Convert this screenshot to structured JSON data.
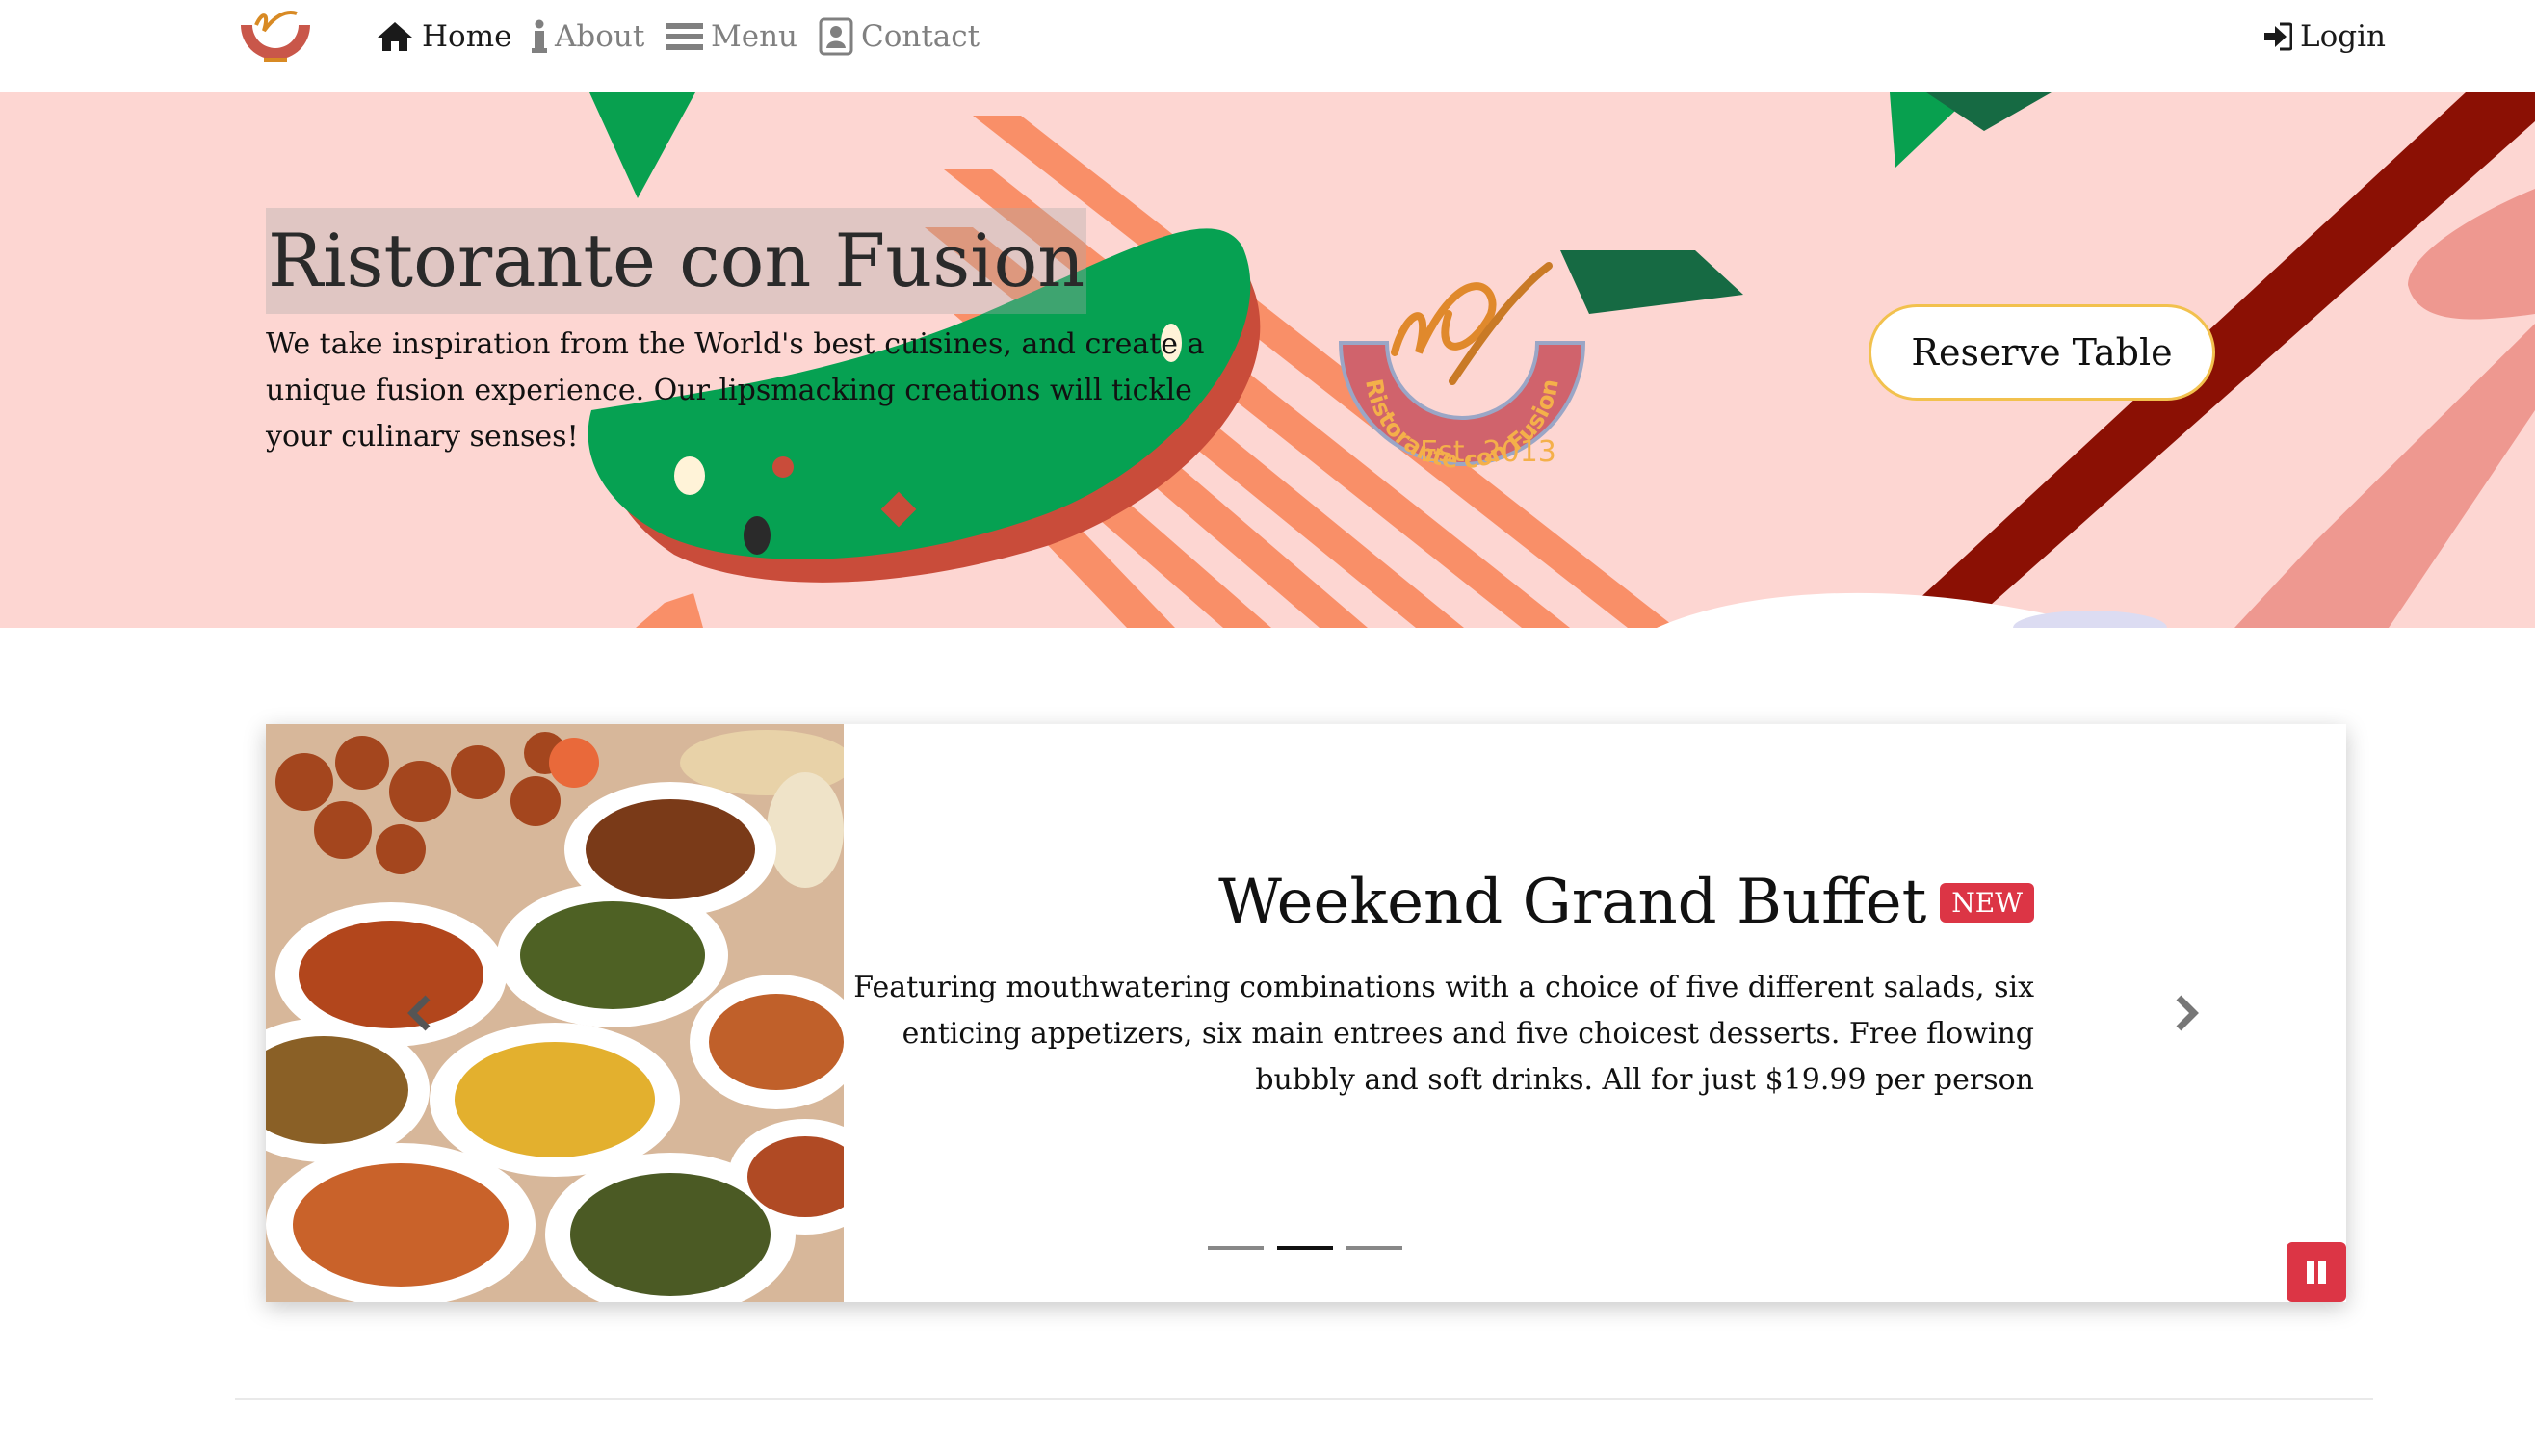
{
  "navbar": {
    "brand_icon": "restaurant-logo",
    "items": [
      {
        "label": "Home",
        "icon": "home-icon",
        "active": true
      },
      {
        "label": "About",
        "icon": "info-icon",
        "active": false
      },
      {
        "label": "Menu",
        "icon": "list-icon",
        "active": false
      },
      {
        "label": "Contact",
        "icon": "address-card-icon",
        "active": false
      }
    ],
    "login": {
      "label": "Login",
      "icon": "sign-in-icon"
    }
  },
  "hero": {
    "title": "Ristorante con Fusion",
    "description": "We take inspiration from the World's best cuisines, and create a unique fusion experience. Our lipsmacking creations will tickle your culinary senses!",
    "logo_text": "Ristorante con Fusion",
    "logo_est": "Est. 2013",
    "reserve_button": "Reserve Table"
  },
  "carousel": {
    "slide": {
      "title": "Weekend Grand Buffet",
      "badge": "NEW",
      "text": "Featuring mouthwatering combinations with a choice of five different salads, six enticing appetizers, six main entrees and five choicest desserts. Free flowing bubbly and soft drinks. All for just $19.99 per person"
    },
    "indicators_count": 3,
    "active_indicator": 2,
    "controls": {
      "prev_icon": "chevron-left-icon",
      "next_icon": "chevron-right-icon",
      "pause_icon": "pause-icon"
    }
  },
  "colors": {
    "hero_bg": "#fdd6d2",
    "badge_red": "#dc3545",
    "reserve_border": "#f2c14e",
    "green_shape": "#06a152",
    "orange_stripe": "#f98f68",
    "dark_red_stripe": "#8b1004"
  }
}
